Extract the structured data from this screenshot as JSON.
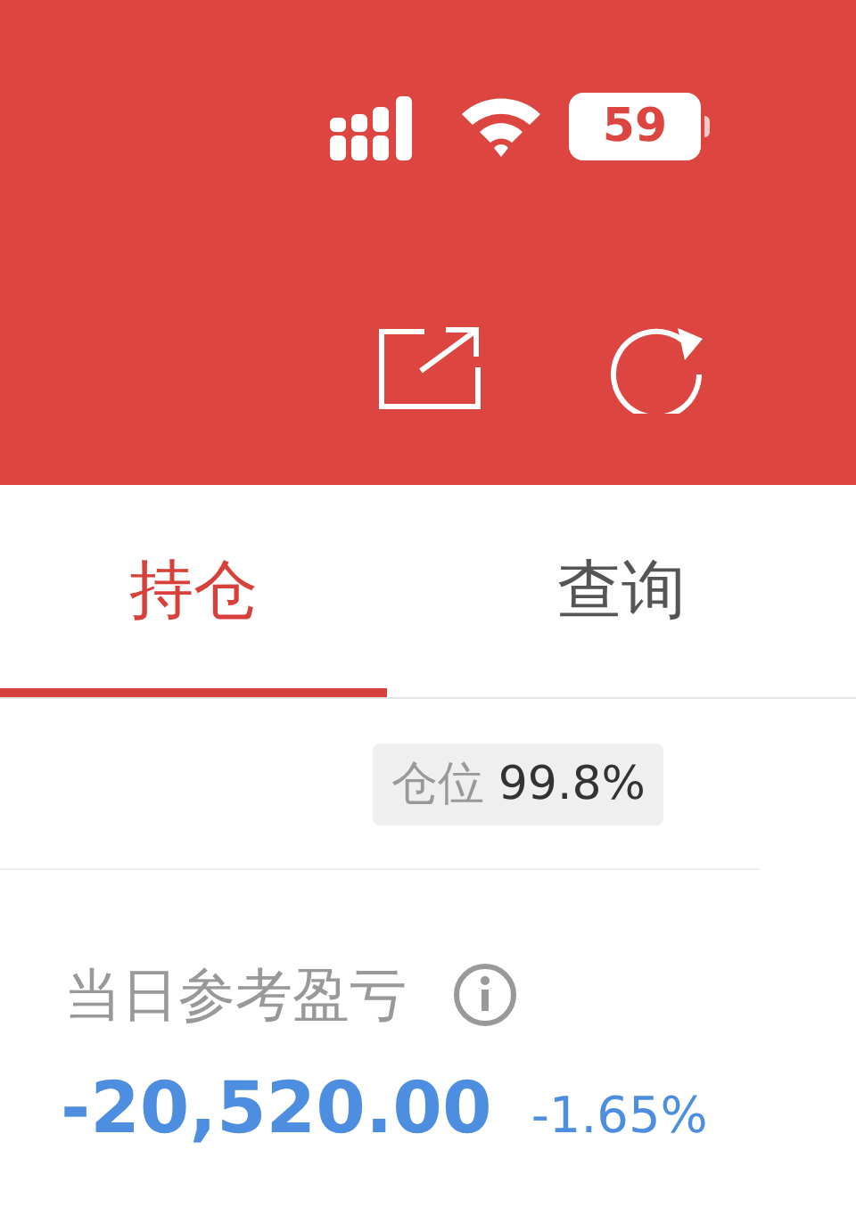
{
  "status_bar": {
    "battery_text": "59"
  },
  "tabs": [
    {
      "label": "持仓",
      "selected": true
    },
    {
      "label": "查询",
      "selected": false
    }
  ],
  "position_badge": {
    "label": "仓位",
    "value": "99.8%"
  },
  "pnl": {
    "label": "当日参考盈亏",
    "amount": "-20,520.00",
    "percent": "-1.65%"
  }
}
